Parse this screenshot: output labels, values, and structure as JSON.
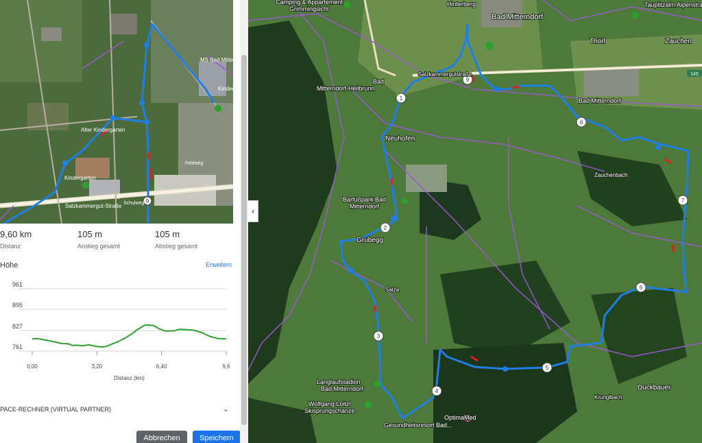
{
  "minimap": {
    "labels": {
      "ms": "MS Bad Mitterndorf",
      "kinder": "Kinder",
      "altenheim": "Alter Kindergarten",
      "kindergarten": "Kindergarten",
      "strasse": "Salzkammergut-Straße",
      "feldweg": "Feldweg",
      "schulweg": "Schulweg"
    },
    "markers": [
      "9"
    ]
  },
  "stats": {
    "distance_value": "9,60 km",
    "distance_label": "Distanz",
    "ascent_value": "105 m",
    "ascent_label": "Anstieg gesamt",
    "descent_value": "105 m",
    "descent_label": "Abstieg gesamt"
  },
  "elevation": {
    "title": "Höhe",
    "expand_link": "Erweitern",
    "x_label": "Distanz (km)",
    "y_ticks": [
      "961",
      "895",
      "827",
      "761"
    ],
    "x_ticks": [
      "0,00",
      "3,20",
      "6,40",
      "9,6"
    ],
    "profile_km": [
      0,
      0.3,
      0.6,
      1.0,
      1.4,
      1.8,
      2.0,
      2.2,
      2.5,
      2.8,
      3.2,
      3.5,
      3.7,
      4.0,
      4.3,
      4.6,
      4.9,
      5.2,
      5.6,
      6.0,
      6.3,
      6.6,
      7.0,
      7.3,
      7.6,
      8.0,
      8.4,
      8.8,
      9.2,
      9.6
    ],
    "profile_m": [
      800,
      801,
      797,
      792,
      786,
      784,
      779,
      780,
      778,
      781,
      776,
      774,
      777,
      785,
      793,
      803,
      815,
      830,
      845,
      843,
      832,
      825,
      826,
      831,
      830,
      828,
      820,
      808,
      801,
      800
    ],
    "y_range": [
      761,
      961
    ],
    "x_range": [
      0,
      9.6
    ],
    "line_color": "#2ca02c"
  },
  "pace": {
    "label": "PACE-RECHNER (VIRTUAL PARTNER)"
  },
  "buttons": {
    "cancel": "Abbrechen",
    "save": "Speichern"
  },
  "map": {
    "places": {
      "camping": "Camping & Appartement",
      "grimming": "Grimmingsicht",
      "hinterberg": "Hinterberg",
      "badmitterndorf": "Bad Mitterndorf",
      "tauplitz": "Tauplitzalm Alpenstraße",
      "thoerl": "Thörl",
      "zauchen": "Zauchen",
      "heilbrunn1": "Bad",
      "heilbrunn2": "Mitterndorf-Heilbrunn",
      "neuhofen": "Neuhofen",
      "salzkammer": "Salzkammergutstraße",
      "barfuss1": "Barfußpark Bad",
      "barfuss2": "Mitterndorf",
      "grubegg": "Grubegg",
      "salza": "Salza",
      "langlauf1": "Langlaufstadion",
      "langlauf2": "Bad Mitterndorf",
      "loitzl1": "Wolfgang Loitzl",
      "loitzl2": "Skisprungschanze",
      "optima": "OptimaMed",
      "gesund": "Gesundheitsresort Bad...",
      "krunglbach": "Krunglbach",
      "duckbauer": "Duckbauer",
      "zauchenbach": "Zauchenbach",
      "badmitterndorf_station": "Bad Mitterndorf",
      "road145": "145"
    },
    "markers": [
      "1",
      "2",
      "3",
      "4",
      "5",
      "6",
      "7",
      "8",
      "9"
    ],
    "route_color": "#1e7fe6",
    "trail_color": "#9b59d0"
  },
  "collapse_icon": "‹"
}
